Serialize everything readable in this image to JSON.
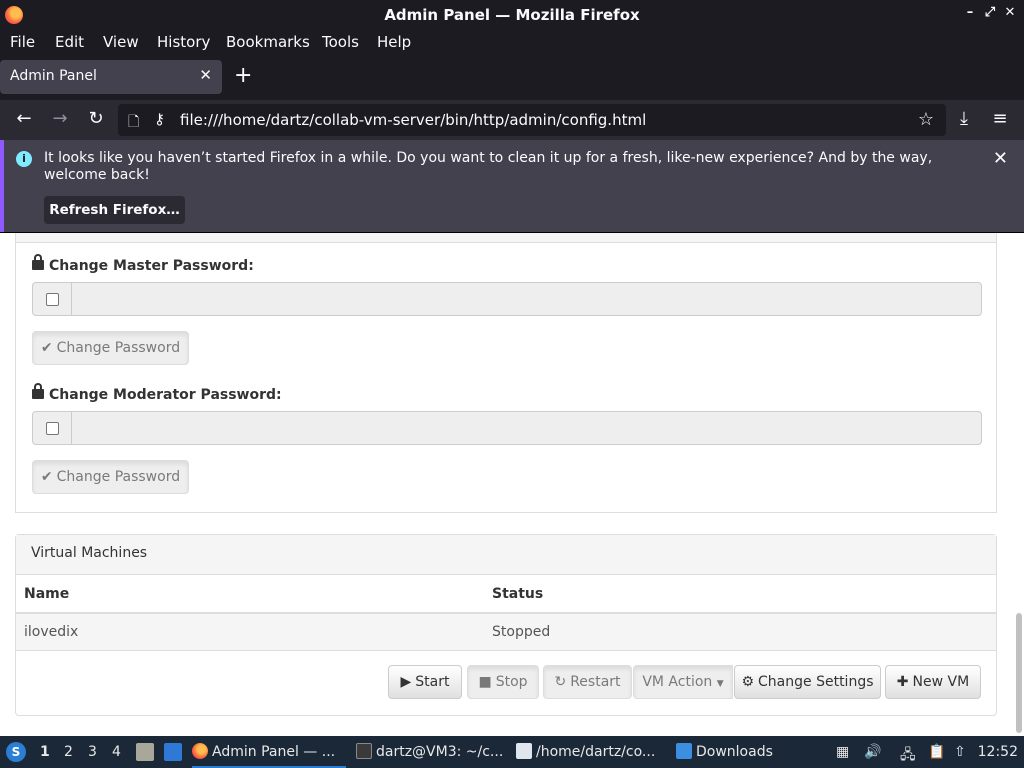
{
  "window": {
    "title": "Admin Panel — Mozilla Firefox"
  },
  "menu": {
    "file": "File",
    "edit": "Edit",
    "view": "View",
    "history": "History",
    "bookmarks": "Bookmarks",
    "tools": "Tools",
    "help": "Help"
  },
  "tab": {
    "label": "Admin Panel",
    "close": "✕",
    "new": "+"
  },
  "nav": {
    "url": "file:///home/dartz/collab-vm-server/bin/http/admin/config.html"
  },
  "notification": {
    "message": "It looks like you haven’t started Firefox in a while. Do you want to clean it up for a fresh, like-new experience? And by the way, welcome back!",
    "button": "Refresh Firefox…"
  },
  "passwords": {
    "master_label": "Change Master Password:",
    "master_value": "",
    "moderator_label": "Change Moderator Password:",
    "moderator_value": "",
    "change_button": "Change Password"
  },
  "vm_panel": {
    "heading": "Virtual Machines",
    "columns": [
      "Name",
      "Status"
    ],
    "rows": [
      {
        "name": "ilovedix",
        "status": "Stopped"
      }
    ],
    "buttons": {
      "start": "Start",
      "stop": "Stop",
      "restart": "Restart",
      "vm_action": "VM Action",
      "change_settings": "Change Settings",
      "new_vm": "New VM"
    }
  },
  "taskbar": {
    "workspaces": [
      "1",
      "2",
      "3",
      "4"
    ],
    "tasks": [
      "Admin Panel — ...",
      "dartz@VM3: ~/c...",
      "/home/dartz/co...",
      "Downloads"
    ],
    "clock": "12:52"
  },
  "colors": {
    "accent": "#9059ff",
    "chrome": "#1c1b22",
    "toolbar": "#2b2a33",
    "taskbar": "#1b2838"
  }
}
